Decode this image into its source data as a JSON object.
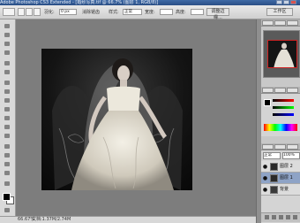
{
  "app": {
    "title": "Adobe Photoshop CS3 Extended - [婚纱写真.tif @ 66.7% (图层 1, RGB/8)]"
  },
  "options_bar": {
    "feather_label": "羽化:",
    "feather_value": "0 px",
    "antialias_label": "消除锯齿",
    "style_label": "样式:",
    "style_value": "正常",
    "width_label": "宽度:",
    "height_label": "高度:",
    "refine_edge_button": "调整边缘...",
    "workspace_label": "工作区"
  },
  "status_bar": {
    "zoom": "66.67%",
    "doc_info": "文档:1.37M/2.74M"
  },
  "panels": {
    "navigator_tabs": [
      "导航器",
      "直方图",
      "信息"
    ],
    "color_tabs": [
      "颜色",
      "色板",
      "样式"
    ],
    "layers_tabs": [
      "图层",
      "通道",
      "路径"
    ],
    "layers_blend_mode": "正常",
    "layers_opacity": "100%",
    "layers": [
      {
        "name": "图层 2",
        "selected": false
      },
      {
        "name": "图层 1",
        "selected": true
      },
      {
        "name": "背景",
        "selected": false
      }
    ]
  },
  "colors": {
    "accent": "#2a4f86",
    "foreground": "#000000",
    "background": "#ffffff",
    "nav_frame": "#d02424"
  }
}
